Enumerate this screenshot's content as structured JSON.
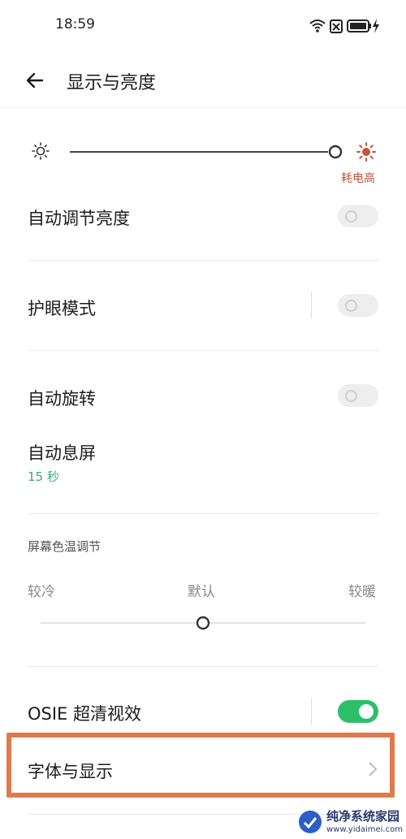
{
  "status_bar": {
    "time": "18:59",
    "icons": [
      "wifi-icon",
      "sim-blocked-icon",
      "battery-charging-icon"
    ]
  },
  "header": {
    "back_icon": "arrow-left-icon",
    "title": "显示与亮度"
  },
  "brightness": {
    "low_icon": "sun-small-icon",
    "high_icon": "sun-large-icon",
    "level": 1.0,
    "warning": "耗电高",
    "warning_color": "#c0553c"
  },
  "settings": {
    "auto_brightness": {
      "label": "自动调节亮度",
      "on": false
    },
    "eye_care": {
      "label": "护眼模式",
      "on": false
    },
    "auto_rotate": {
      "label": "自动旋转",
      "on": false
    },
    "screen_timeout": {
      "label": "自动息屏",
      "value": "15 秒",
      "value_color": "#3aaa7c"
    }
  },
  "color_temperature": {
    "section_title": "屏幕色温调节",
    "cool_label": "较冷",
    "default_label": "默认",
    "warm_label": "较暖",
    "level": 0.5
  },
  "osie": {
    "label": "OSIE 超清视效",
    "on": true,
    "accent": "#2cbf6a"
  },
  "font_display": {
    "label": "字体与显示",
    "chevron_icon": "chevron-right-icon"
  },
  "watermark": {
    "title": "纯净系统家园",
    "url": "www.yidaimei.com"
  }
}
